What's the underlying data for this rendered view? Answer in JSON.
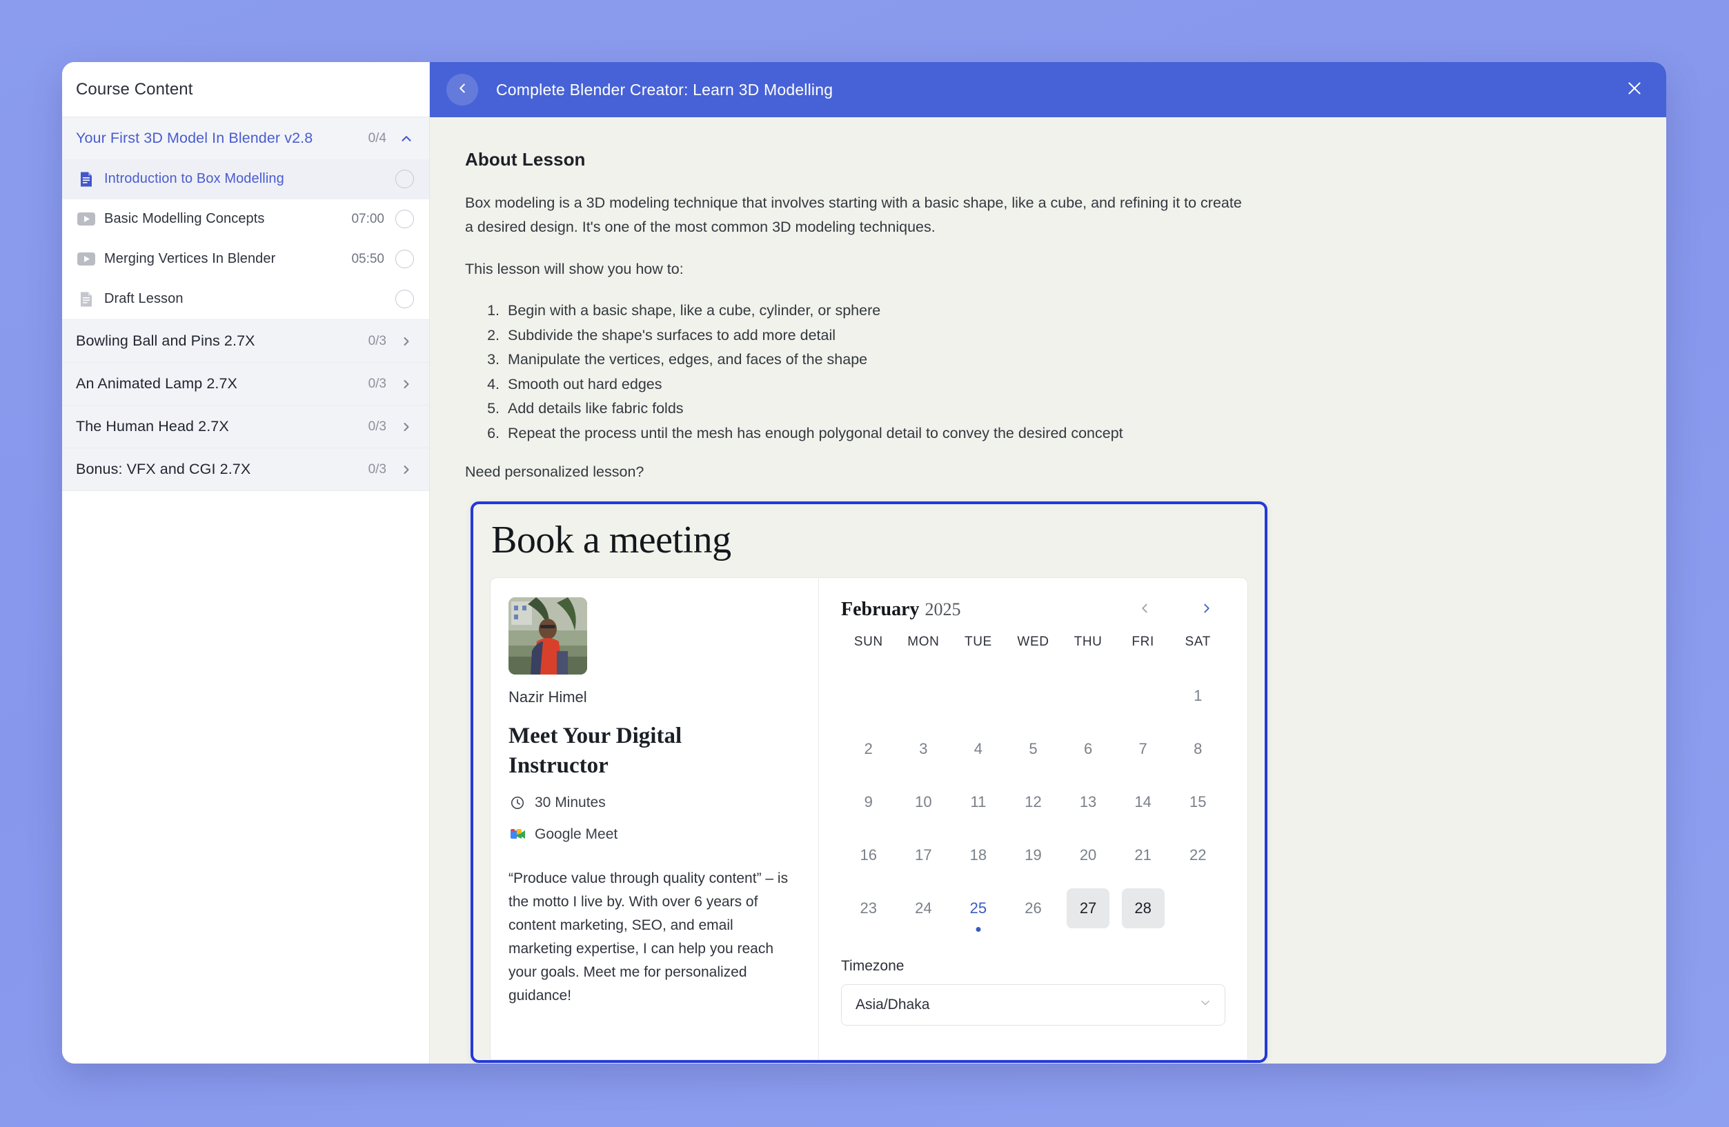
{
  "sidebar": {
    "header_title": "Course Content",
    "sections": [
      {
        "title": "Your First 3D Model In Blender v2.8",
        "count": "0/4",
        "expanded": true,
        "lessons": [
          {
            "icon": "document-blue-icon",
            "label": "Introduction to Box Modelling",
            "duration": "",
            "active": true
          },
          {
            "icon": "video-play-icon",
            "label": "Basic Modelling Concepts",
            "duration": "07:00",
            "active": false
          },
          {
            "icon": "video-play-icon",
            "label": "Merging Vertices In Blender",
            "duration": "05:50",
            "active": false
          },
          {
            "icon": "document-gray-icon",
            "label": "Draft Lesson",
            "duration": "",
            "active": false
          }
        ]
      },
      {
        "title": "Bowling Ball and Pins 2.7X",
        "count": "0/3",
        "expanded": false,
        "lessons": []
      },
      {
        "title": "An Animated Lamp 2.7X",
        "count": "0/3",
        "expanded": false,
        "lessons": []
      },
      {
        "title": "The Human Head 2.7X",
        "count": "0/3",
        "expanded": false,
        "lessons": []
      },
      {
        "title": "Bonus: VFX and CGI 2.7X",
        "count": "0/3",
        "expanded": false,
        "lessons": []
      }
    ]
  },
  "topbar": {
    "title": "Complete Blender Creator: Learn 3D Modelling",
    "back_icon": "chevron-left-icon",
    "close_icon": "close-icon",
    "bg_color": "#4762d6"
  },
  "lesson": {
    "about_heading": "About Lesson",
    "intro_paragraph": "Box modeling is a 3D modeling technique that involves starting with a basic shape, like a cube, and refining it to create a desired design. It's one of the most common 3D modeling techniques.",
    "lead_in": "This lesson will show you how to:",
    "steps": [
      "Begin with a basic shape, like a cube, cylinder, or sphere",
      "Subdivide the shape's surfaces to add more detail",
      "Manipulate the vertices, edges, and faces of the shape",
      "Smooth out hard edges",
      "Add details like fabric folds",
      "Repeat the process until the mesh has enough polygonal detail to convey the desired concept"
    ],
    "need_lesson": "Need personalized lesson?"
  },
  "booking": {
    "title": "Book a meeting",
    "border_color": "#2438dc",
    "instructor": {
      "name": "Nazir Himel",
      "meeting_title": "Meet Your Digital Instructor",
      "duration": "30 Minutes",
      "duration_icon": "clock-icon",
      "platform": "Google Meet",
      "platform_icon": "google-meet-icon",
      "bio": "“Produce value through quality content” – is the motto I live by. With over 6 years of content marketing, SEO, and email marketing expertise, I can help you reach your goals. Meet me for personalized guidance!"
    },
    "calendar": {
      "month": "February",
      "year": "2025",
      "prev_icon": "chevron-left-icon",
      "next_icon": "chevron-right-icon",
      "prev_enabled": false,
      "next_enabled": true,
      "day_headers": [
        "SUN",
        "MON",
        "TUE",
        "WED",
        "THU",
        "FRI",
        "SAT"
      ],
      "leading_blanks": 6,
      "days": [
        {
          "n": "1",
          "state": "normal"
        },
        {
          "n": "2",
          "state": "normal"
        },
        {
          "n": "3",
          "state": "normal"
        },
        {
          "n": "4",
          "state": "normal"
        },
        {
          "n": "5",
          "state": "normal"
        },
        {
          "n": "6",
          "state": "normal"
        },
        {
          "n": "7",
          "state": "normal"
        },
        {
          "n": "8",
          "state": "normal"
        },
        {
          "n": "9",
          "state": "normal"
        },
        {
          "n": "10",
          "state": "normal"
        },
        {
          "n": "11",
          "state": "normal"
        },
        {
          "n": "12",
          "state": "normal"
        },
        {
          "n": "13",
          "state": "normal"
        },
        {
          "n": "14",
          "state": "normal"
        },
        {
          "n": "15",
          "state": "normal"
        },
        {
          "n": "16",
          "state": "normal"
        },
        {
          "n": "17",
          "state": "normal"
        },
        {
          "n": "18",
          "state": "normal"
        },
        {
          "n": "19",
          "state": "normal"
        },
        {
          "n": "20",
          "state": "normal"
        },
        {
          "n": "21",
          "state": "normal"
        },
        {
          "n": "22",
          "state": "normal"
        },
        {
          "n": "23",
          "state": "normal"
        },
        {
          "n": "24",
          "state": "normal"
        },
        {
          "n": "25",
          "state": "today"
        },
        {
          "n": "26",
          "state": "normal"
        },
        {
          "n": "27",
          "state": "available"
        },
        {
          "n": "28",
          "state": "available"
        }
      ],
      "today_accent": "#3b5ac4",
      "available_bg": "#e7e8ea"
    },
    "timezone": {
      "label": "Timezone",
      "value": "Asia/Dhaka",
      "chevron_icon": "chevron-down-icon"
    }
  }
}
